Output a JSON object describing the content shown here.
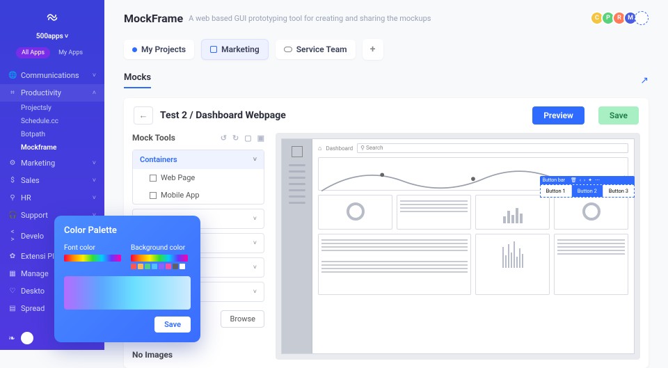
{
  "brand": {
    "name": "500apps"
  },
  "sidebar": {
    "pills": {
      "all": "All Apps",
      "mine": "My Apps"
    },
    "cats": [
      {
        "icon": "🌐",
        "label": "Communications",
        "chev": "˅"
      },
      {
        "icon": "⌗",
        "label": "Productivity",
        "chev": "˄",
        "highlight": true,
        "subs": [
          "Projectsly",
          "Schedule.cc",
          "Botpath",
          "Mockframe"
        ],
        "active_sub": 3
      },
      {
        "icon": "⚙",
        "label": "Marketing",
        "chev": "˅"
      },
      {
        "icon": "$",
        "label": "Sales",
        "chev": "˅"
      },
      {
        "icon": "⚲",
        "label": "HR",
        "chev": "˅"
      },
      {
        "icon": "🎧",
        "label": "Support",
        "chev": "˅"
      },
      {
        "icon": "< >",
        "label": "Develo",
        "chev": ""
      },
      {
        "icon": "✿",
        "label": "Extensi\nPlugins",
        "chev": ""
      },
      {
        "icon": "▦",
        "label": "Manage",
        "chev": ""
      },
      {
        "icon": "♡",
        "label": "Deskto",
        "chev": ""
      },
      {
        "icon": "▤",
        "label": "Spread",
        "chev": ""
      }
    ]
  },
  "header": {
    "title": "MockFrame",
    "subtitle": "A web based GUI prototyping tool for creating and sharing the mockups",
    "avatars": [
      {
        "bg": "#f5c542",
        "t": "C"
      },
      {
        "bg": "#5ad27a",
        "t": "P"
      },
      {
        "bg": "#ff7a59",
        "t": "R"
      },
      {
        "bg": "#4a5de0",
        "t": "M"
      },
      {
        "bg": "#ffffff",
        "t": ""
      }
    ]
  },
  "tabs": {
    "items": [
      "My Projects",
      "Marketing",
      "Service Team"
    ],
    "active": 1
  },
  "section": {
    "title": "Mocks"
  },
  "crumb": {
    "back": "←",
    "path": "Test 2 / Dashboard Webpage",
    "preview": "Preview",
    "save": "Save"
  },
  "tools": {
    "title": "Mock Tools",
    "cats": [
      {
        "name": "Containers",
        "open": true,
        "items": [
          "Web Page",
          "Mobile App"
        ]
      },
      {
        "name": "",
        "open": false
      },
      {
        "name": "",
        "open": false
      },
      {
        "name": "",
        "open": false
      },
      {
        "name": "",
        "open": false
      }
    ],
    "browse": "Browse",
    "noimg": "No Images"
  },
  "mock": {
    "crumb_home": "⌂",
    "crumb_label": "Dashboard",
    "search_placeholder": "⚲ Search",
    "buttonbar": {
      "label": "Button bar",
      "buttons": [
        "Button 1",
        "Button 2",
        "Button 3"
      ],
      "active": 1
    }
  },
  "palette": {
    "title": "Color Palette",
    "font_label": "Font color",
    "bg_label": "Background color",
    "swatches": [
      "#ff5550",
      "#ffb950",
      "#50d080",
      "#50c0ff",
      "#9060ff",
      "#ff50a0",
      "#606060",
      "#ffffff"
    ],
    "save": "Save"
  }
}
